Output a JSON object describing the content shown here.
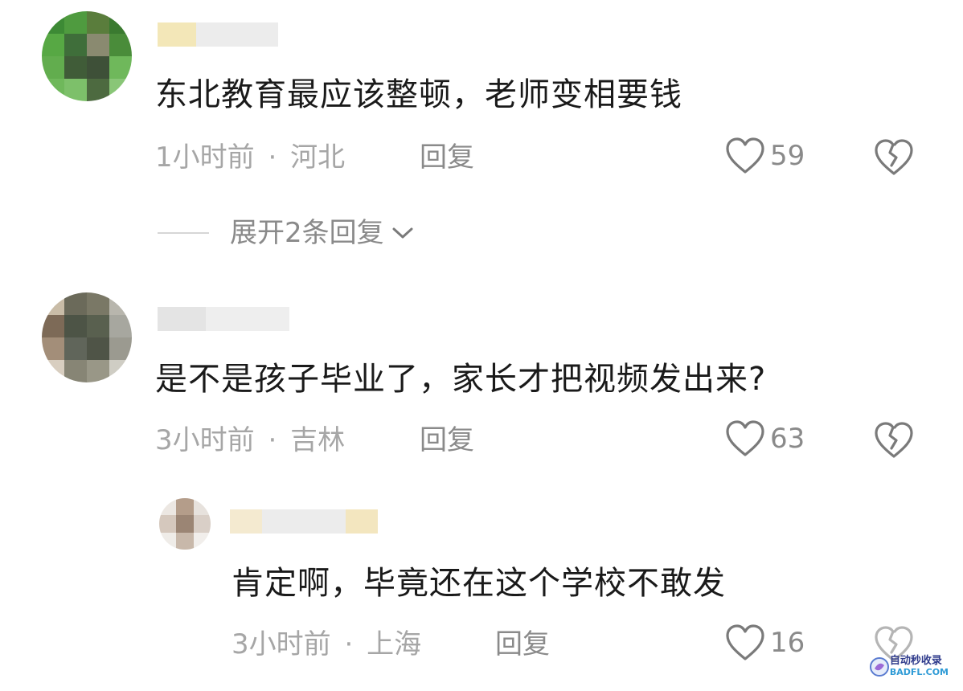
{
  "comments": [
    {
      "text": "东北教育最应该整顿，老师变相要钱",
      "time": "1小时前",
      "separator": "·",
      "location": "河北",
      "reply_label": "回复",
      "likes": "59",
      "expand_label": "展开2条回复"
    },
    {
      "text": "是不是孩子毕业了，家长才把视频发出来?",
      "time": "3小时前",
      "separator": "·",
      "location": "吉林",
      "reply_label": "回复",
      "likes": "63"
    },
    {
      "text": "肯定啊，毕竟还在这个学校不敢发",
      "time": "3小时前",
      "separator": "·",
      "location": "上海",
      "reply_label": "回复",
      "likes": "16"
    }
  ],
  "colors": {
    "text_primary": "#1a1a1a",
    "text_meta": "#a6a6a6",
    "text_secondary": "#8a8a8a",
    "icon_stroke": "#7a7a7a"
  },
  "icons": [
    "heart-icon",
    "broken-heart-icon",
    "chevron-down-icon"
  ],
  "watermark": {
    "line1": "自动秒收录",
    "line2": "BADFL.COM"
  }
}
